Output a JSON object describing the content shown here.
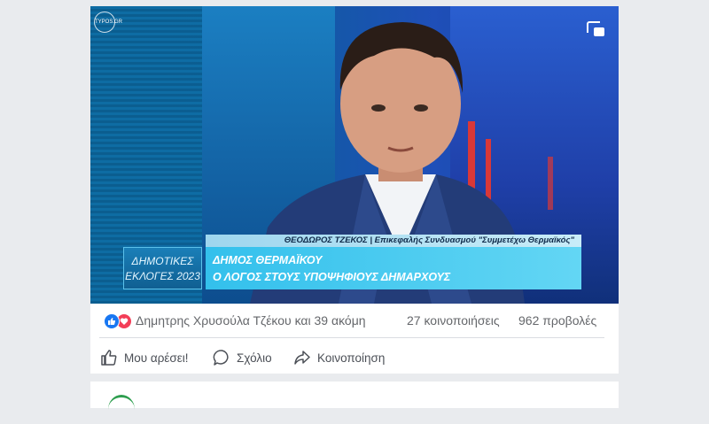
{
  "video": {
    "channel_logo": "TYPOS.GR",
    "pip_icon": "picture-in-picture-icon",
    "lower_third": {
      "name_line": "ΘΕΟΔΩΡΟΣ ΤΖΕΚΟΣ | Επικεφαλής Συνδυασμού \"Συμμετέχω Θερμαϊκός\"",
      "box_line1": "ΔΗΜΟΤΙΚΕΣ",
      "box_line2": "ΕΚΛΟΓΕΣ 2023",
      "headline1": "ΔΗΜΟΣ ΘΕΡΜΑΪΚΟΥ",
      "headline2": "Ο ΛΟΓΟΣ ΣΤΟΥΣ ΥΠΟΨΗΦΙΟΥΣ ΔΗΜΑΡΧΟΥΣ"
    }
  },
  "stats": {
    "reaction_icons": [
      "like-icon",
      "love-icon"
    ],
    "reactors": "Δημητρης Χρυσούλα Τζέκου και 39 ακόμη",
    "shares": "27 κοινοποιήσεις",
    "views": "962 προβολές"
  },
  "actions": {
    "like": "Μου αρέσει!",
    "comment": "Σχόλιο",
    "share": "Κοινοποίηση"
  },
  "colors": {
    "page_bg": "#e9ebee",
    "card_bg": "#ffffff",
    "like_blue": "#1877f2",
    "love_red": "#f33e58",
    "muted_text": "#65676b",
    "lower_third_cyan": "#33c0ec"
  }
}
